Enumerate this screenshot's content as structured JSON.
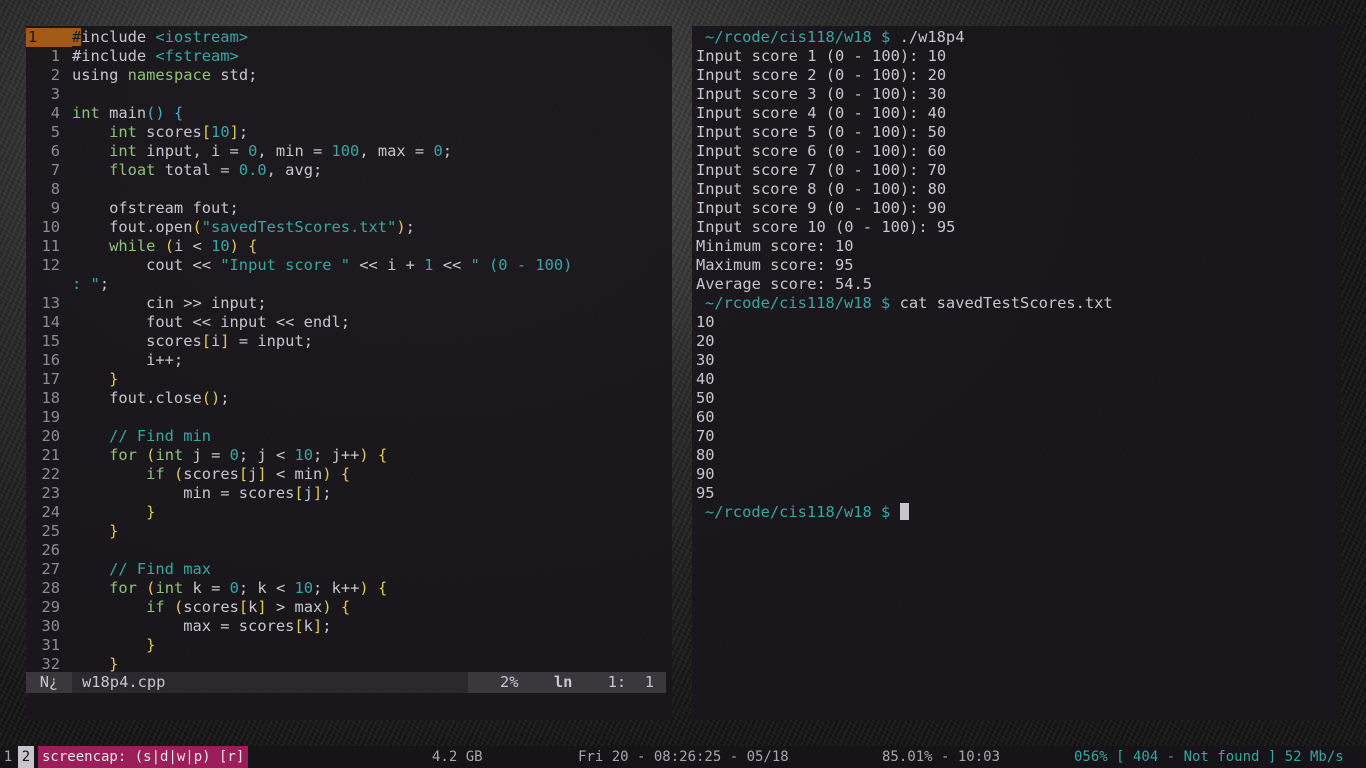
{
  "editor": {
    "lines": [
      {
        "n": "1",
        "current": true,
        "segs": [
          [
            "cursor-char",
            "#"
          ],
          [
            "pp",
            "include "
          ],
          [
            "inc",
            "<iostream>"
          ]
        ]
      },
      {
        "n": "1",
        "segs": [
          [
            "pp",
            "#include "
          ],
          [
            "inc",
            "<fstream>"
          ]
        ]
      },
      {
        "n": "2",
        "segs": [
          [
            "pp",
            "using "
          ],
          [
            "kw",
            "namespace"
          ],
          [
            "pp",
            " std;"
          ]
        ]
      },
      {
        "n": "3",
        "segs": []
      },
      {
        "n": "4",
        "segs": [
          [
            "kw",
            "int"
          ],
          [
            "pp",
            " main"
          ],
          [
            "pr",
            "()"
          ],
          [
            "pp",
            " "
          ],
          [
            "pr",
            "{"
          ]
        ]
      },
      {
        "n": "5",
        "segs": [
          [
            "pp",
            "    "
          ],
          [
            "kw",
            "int"
          ],
          [
            "pp",
            " scores"
          ],
          [
            "br",
            "["
          ],
          [
            "num",
            "10"
          ],
          [
            "br",
            "]"
          ],
          [
            "pp",
            ";"
          ]
        ]
      },
      {
        "n": "6",
        "segs": [
          [
            "pp",
            "    "
          ],
          [
            "kw",
            "int"
          ],
          [
            "pp",
            " input, i = "
          ],
          [
            "num",
            "0"
          ],
          [
            "pp",
            ", min = "
          ],
          [
            "num",
            "100"
          ],
          [
            "pp",
            ", max = "
          ],
          [
            "num",
            "0"
          ],
          [
            "pp",
            ";"
          ]
        ]
      },
      {
        "n": "7",
        "segs": [
          [
            "pp",
            "    "
          ],
          [
            "kw",
            "float"
          ],
          [
            "pp",
            " total = "
          ],
          [
            "num",
            "0.0"
          ],
          [
            "pp",
            ", avg;"
          ]
        ]
      },
      {
        "n": "8",
        "segs": []
      },
      {
        "n": "9",
        "segs": [
          [
            "pp",
            "    ofstream fout;"
          ]
        ]
      },
      {
        "n": "10",
        "segs": [
          [
            "pp",
            "    fout.open"
          ],
          [
            "br",
            "("
          ],
          [
            "str",
            "\"savedTestScores.txt\""
          ],
          [
            "br",
            ")"
          ],
          [
            "pp",
            ";"
          ]
        ]
      },
      {
        "n": "11",
        "segs": [
          [
            "pp",
            "    "
          ],
          [
            "kw",
            "while"
          ],
          [
            "pp",
            " "
          ],
          [
            "br",
            "("
          ],
          [
            "pp",
            "i < "
          ],
          [
            "num",
            "10"
          ],
          [
            "br",
            ")"
          ],
          [
            "pp",
            " "
          ],
          [
            "br",
            "{"
          ]
        ]
      },
      {
        "n": "12",
        "segs": [
          [
            "pp",
            "        cout << "
          ],
          [
            "str",
            "\"Input score \""
          ],
          [
            "pp",
            " << i + "
          ],
          [
            "num",
            "1"
          ],
          [
            "pp",
            " << "
          ],
          [
            "str",
            "\" (0 - 100)"
          ]
        ]
      },
      {
        "n": "",
        "wrap": true,
        "segs": [
          [
            "str",
            ": \""
          ],
          [
            "pp",
            ";"
          ]
        ]
      },
      {
        "n": "13",
        "segs": [
          [
            "pp",
            "        cin >> input;"
          ]
        ]
      },
      {
        "n": "14",
        "segs": [
          [
            "pp",
            "        fout << input << endl;"
          ]
        ]
      },
      {
        "n": "15",
        "segs": [
          [
            "pp",
            "        scores"
          ],
          [
            "br",
            "["
          ],
          [
            "pp",
            "i"
          ],
          [
            "br",
            "]"
          ],
          [
            "pp",
            " = input;"
          ]
        ]
      },
      {
        "n": "16",
        "segs": [
          [
            "pp",
            "        i++;"
          ]
        ]
      },
      {
        "n": "17",
        "segs": [
          [
            "pp",
            "    "
          ],
          [
            "br",
            "}"
          ]
        ]
      },
      {
        "n": "18",
        "segs": [
          [
            "pp",
            "    fout.close"
          ],
          [
            "br",
            "()"
          ],
          [
            "pp",
            ";"
          ]
        ]
      },
      {
        "n": "19",
        "segs": []
      },
      {
        "n": "20",
        "segs": [
          [
            "pp",
            "    "
          ],
          [
            "com",
            "// Find min"
          ]
        ]
      },
      {
        "n": "21",
        "segs": [
          [
            "pp",
            "    "
          ],
          [
            "kw",
            "for"
          ],
          [
            "pp",
            " "
          ],
          [
            "br",
            "("
          ],
          [
            "kw",
            "int"
          ],
          [
            "pp",
            " j = "
          ],
          [
            "num",
            "0"
          ],
          [
            "pp",
            "; j < "
          ],
          [
            "num",
            "10"
          ],
          [
            "pp",
            "; j++"
          ],
          [
            "br",
            ")"
          ],
          [
            "pp",
            " "
          ],
          [
            "br",
            "{"
          ]
        ]
      },
      {
        "n": "22",
        "segs": [
          [
            "pp",
            "        "
          ],
          [
            "kw",
            "if"
          ],
          [
            "pp",
            " "
          ],
          [
            "br",
            "("
          ],
          [
            "pp",
            "scores"
          ],
          [
            "br",
            "["
          ],
          [
            "pp",
            "j"
          ],
          [
            "br",
            "]"
          ],
          [
            "pp",
            " < min"
          ],
          [
            "br",
            ")"
          ],
          [
            "pp",
            " "
          ],
          [
            "br",
            "{"
          ]
        ]
      },
      {
        "n": "23",
        "segs": [
          [
            "pp",
            "            min = scores"
          ],
          [
            "br",
            "["
          ],
          [
            "pp",
            "j"
          ],
          [
            "br",
            "]"
          ],
          [
            "pp",
            ";"
          ]
        ]
      },
      {
        "n": "24",
        "segs": [
          [
            "pp",
            "        "
          ],
          [
            "br",
            "}"
          ]
        ]
      },
      {
        "n": "25",
        "segs": [
          [
            "pp",
            "    "
          ],
          [
            "br",
            "}"
          ]
        ]
      },
      {
        "n": "26",
        "segs": []
      },
      {
        "n": "27",
        "segs": [
          [
            "pp",
            "    "
          ],
          [
            "com",
            "// Find max"
          ]
        ]
      },
      {
        "n": "28",
        "segs": [
          [
            "pp",
            "    "
          ],
          [
            "kw",
            "for"
          ],
          [
            "pp",
            " "
          ],
          [
            "br",
            "("
          ],
          [
            "kw",
            "int"
          ],
          [
            "pp",
            " k = "
          ],
          [
            "num",
            "0"
          ],
          [
            "pp",
            "; k < "
          ],
          [
            "num",
            "10"
          ],
          [
            "pp",
            "; k++"
          ],
          [
            "br",
            ")"
          ],
          [
            "pp",
            " "
          ],
          [
            "br",
            "{"
          ]
        ]
      },
      {
        "n": "29",
        "segs": [
          [
            "pp",
            "        "
          ],
          [
            "kw",
            "if"
          ],
          [
            "pp",
            " "
          ],
          [
            "br",
            "("
          ],
          [
            "pp",
            "scores"
          ],
          [
            "br",
            "["
          ],
          [
            "pp",
            "k"
          ],
          [
            "br",
            "]"
          ],
          [
            "pp",
            " > max"
          ],
          [
            "br",
            ")"
          ],
          [
            "pp",
            " "
          ],
          [
            "br",
            "{"
          ]
        ]
      },
      {
        "n": "30",
        "segs": [
          [
            "pp",
            "            max = scores"
          ],
          [
            "br",
            "["
          ],
          [
            "pp",
            "k"
          ],
          [
            "br",
            "]"
          ],
          [
            "pp",
            ";"
          ]
        ]
      },
      {
        "n": "31",
        "segs": [
          [
            "pp",
            "        "
          ],
          [
            "br",
            "}"
          ]
        ]
      },
      {
        "n": "32",
        "segs": [
          [
            "pp",
            "    "
          ],
          [
            "br",
            "}"
          ]
        ]
      }
    ],
    "status": {
      "mode": "N¿",
      "filename": "w18p4.cpp",
      "percent": "2%",
      "ln": "ln",
      "position": "1:  1"
    }
  },
  "terminal": {
    "lines": [
      {
        "prompt": "~/rcode/cis118/w18 $ ",
        "cmd": "./w18p4"
      },
      {
        "text": "Input score 1 (0 - 100): 10"
      },
      {
        "text": "Input score 2 (0 - 100): 20"
      },
      {
        "text": "Input score 3 (0 - 100): 30"
      },
      {
        "text": "Input score 4 (0 - 100): 40"
      },
      {
        "text": "Input score 5 (0 - 100): 50"
      },
      {
        "text": "Input score 6 (0 - 100): 60"
      },
      {
        "text": "Input score 7 (0 - 100): 70"
      },
      {
        "text": "Input score 8 (0 - 100): 80"
      },
      {
        "text": "Input score 9 (0 - 100): 90"
      },
      {
        "text": "Input score 10 (0 - 100): 95"
      },
      {
        "text": "Minimum score: 10"
      },
      {
        "text": "Maximum score: 95"
      },
      {
        "text": "Average score: 54.5"
      },
      {
        "prompt": "~/rcode/cis118/w18 $ ",
        "cmd": "cat savedTestScores.txt"
      },
      {
        "text": "10"
      },
      {
        "text": "20"
      },
      {
        "text": "30"
      },
      {
        "text": "40"
      },
      {
        "text": "50"
      },
      {
        "text": "60"
      },
      {
        "text": "70"
      },
      {
        "text": "80"
      },
      {
        "text": "90"
      },
      {
        "text": "95"
      },
      {
        "prompt": "~/rcode/cis118/w18 $ ",
        "cmd": "",
        "cursor": true
      }
    ]
  },
  "statusbar": {
    "workspace_1": "1",
    "workspace_2": "2",
    "screencap": "screencap: (s|d|w|p) [r]",
    "memory": "4.2 GB",
    "datetime": "Fri 20 - 08:26:25 - 05/18",
    "battery": "85.01% - 10:03",
    "network": "056% [ 404 - Not found ] 52 Mb/s"
  }
}
